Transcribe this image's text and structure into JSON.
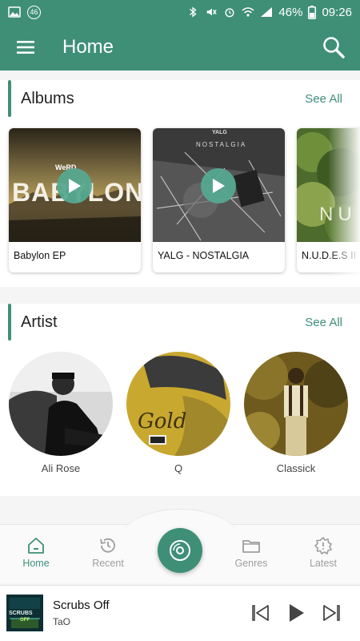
{
  "status_bar": {
    "sim_badge": "46",
    "battery": "46%",
    "time": "09:26"
  },
  "app_bar": {
    "title": "Home"
  },
  "albums": {
    "title": "Albums",
    "see_all": "See All",
    "items": [
      {
        "title": "Babylon EP",
        "art_text": "BABYLON",
        "art_small": "WeRD"
      },
      {
        "title": "YALG - NOSTALGIA",
        "art_text": "NOSTALGIA",
        "art_small": "YALG"
      },
      {
        "title": "N.U.D.E.S II",
        "art_text": "NU"
      }
    ]
  },
  "artists": {
    "title": "Artist",
    "see_all": "See All",
    "items": [
      {
        "name": "Ali Rose"
      },
      {
        "name": "Q",
        "art_text": "Gold"
      },
      {
        "name": "Classick"
      }
    ]
  },
  "bottom_nav": {
    "items": [
      {
        "label": "Home",
        "icon": "home-icon",
        "active": true
      },
      {
        "label": "Recent",
        "icon": "history-icon",
        "active": false
      },
      {
        "label": "Genres",
        "icon": "folder-icon",
        "active": false
      },
      {
        "label": "Latest",
        "icon": "gear-icon",
        "active": false
      }
    ],
    "center_icon": "disc-icon"
  },
  "mini_player": {
    "title": "Scrubs Off",
    "artist": "TaO",
    "art_text_1": "SCRUBS",
    "art_text_2": "OFF"
  },
  "colors": {
    "primary": "#3f8f77",
    "accent": "#56a890",
    "nav_inactive": "#9e9e9e"
  }
}
